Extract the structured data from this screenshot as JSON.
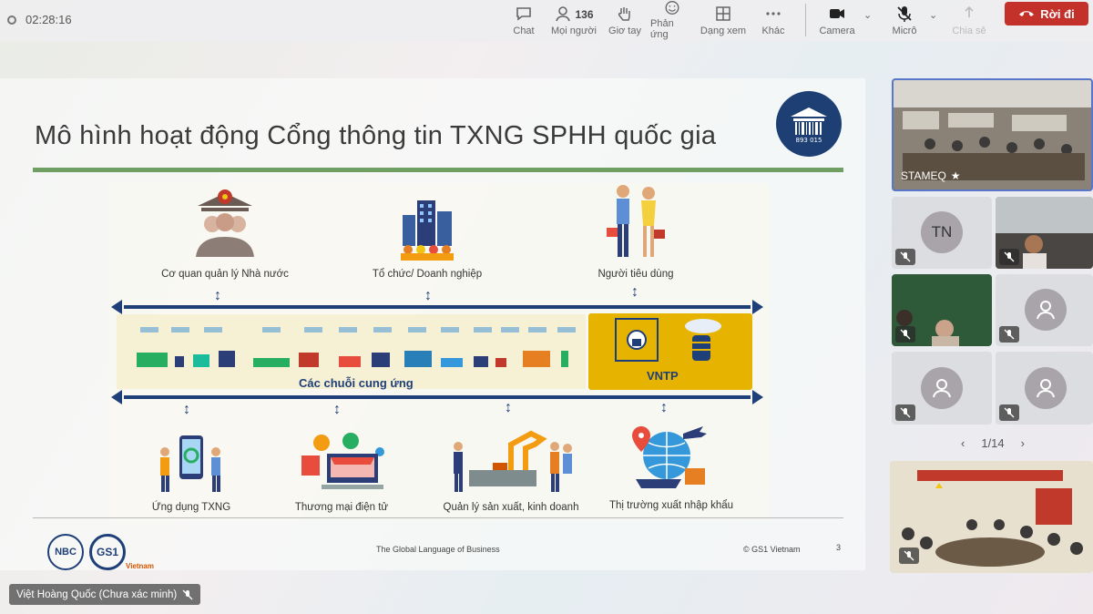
{
  "toolbar": {
    "timer": "02:28:16",
    "chat_label": "Chat",
    "people_label": "Mọi người",
    "people_count": "136",
    "raise_hand_label": "Giơ tay",
    "react_label": "Phản ứng",
    "view_label": "Dạng xem",
    "more_label": "Khác",
    "camera_label": "Camera",
    "mic_label": "Micrô",
    "share_label": "Chia sẻ",
    "leave_label": "Rời đi"
  },
  "slide": {
    "title": "Mô hình hoạt động Cổng thông tin TXNG SPHH quốc gia",
    "logo_text": "893 015",
    "top_actors": [
      "Cơ quan quản lý Nhà nước",
      "Tổ chức/ Doanh nghiệp",
      "Người tiêu dùng"
    ],
    "chain_label": "Các chuỗi cung ứng",
    "vntp_label": "VNTP",
    "bottom_actors": [
      "Ứng dụng TXNG",
      "Thương mại điện tử",
      "Quản lý sản xuất, kinh doanh",
      "Thị trường xuất nhập khẩu"
    ],
    "footer_center": "The Global Language of Business",
    "footer_right": "© GS1 Vietnam",
    "page_number": "3",
    "logo_nbc": "NBC",
    "logo_gs1": "GS1",
    "logo_gs1_sub": "Vietnam"
  },
  "participants": {
    "main_tile_name": "STAMEQ",
    "tn_initials": "TN",
    "pager": "1/14"
  },
  "presenter_badge": "Việt Hoàng Quốc (Chưa xác minh)",
  "colors": {
    "leave": "#c4312b",
    "bus": "#1f3f78",
    "vntp": "#e6b400",
    "title_line": "#6f9f63",
    "active_tile_border": "#5a76c9"
  }
}
